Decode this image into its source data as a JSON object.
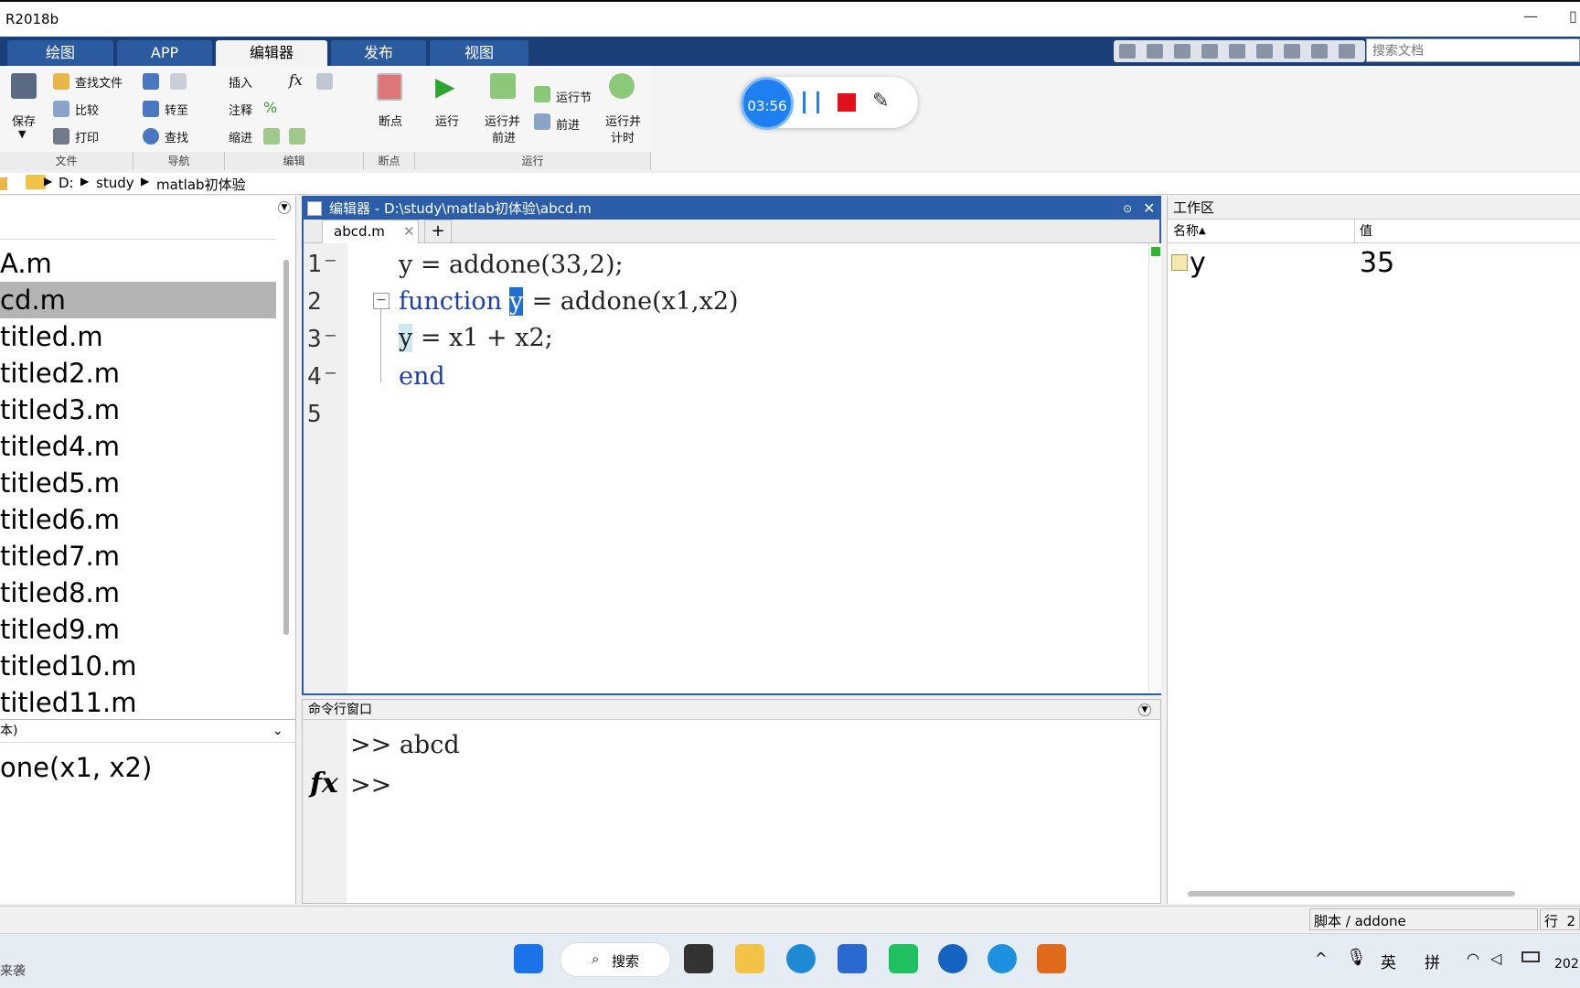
{
  "window": {
    "title": "R2018b"
  },
  "tabs": [
    "绘图",
    "APP",
    "编辑器",
    "发布",
    "视图"
  ],
  "search_placeholder": "搜索文档",
  "ribbon": {
    "file": {
      "save": "保存",
      "find_files": "查找文件",
      "compare": "比较",
      "print": "打印",
      "group": "文件"
    },
    "nav": {
      "goto": "转至",
      "find": "查找",
      "group": "导航"
    },
    "edit": {
      "insert": "插入",
      "comment": "注释",
      "indent": "缩进",
      "fx": "fx",
      "group": "编辑"
    },
    "breakpoints": {
      "label": "断点",
      "group": "断点"
    },
    "run": {
      "run": "运行",
      "run_advance_1": "运行并",
      "run_advance_2": "前进",
      "run_section": "运行节",
      "advance": "前进",
      "run_time_1": "运行并",
      "run_time_2": "计时",
      "group": "运行"
    }
  },
  "recorder": {
    "time": "03:56"
  },
  "path": [
    "D:",
    "study",
    "matlab初体验"
  ],
  "files": {
    "items": [
      "A.m",
      "cd.m",
      "titled.m",
      "titled2.m",
      "titled3.m",
      "titled4.m",
      "titled5.m",
      "titled6.m",
      "titled7.m",
      "titled8.m",
      "titled9.m",
      "titled10.m",
      "titled11.m"
    ],
    "selected_index": 1,
    "details_header": "本)",
    "details_sig": "one(x1, x2)"
  },
  "editor": {
    "title": "编辑器 - D:\\study\\matlab初体验\\abcd.m",
    "tab": "abcd.m",
    "add_tab": "+",
    "line_numbers": [
      "1",
      "2",
      "3",
      "4",
      "5"
    ],
    "lines": [
      "y = addone(33,2);",
      "function",
      "y",
      " = addone(x1,x2)",
      "y = x1 + x2;",
      "end"
    ]
  },
  "command": {
    "title": "命令行窗口",
    "line1": ">> abcd",
    "prompt": ">>",
    "fx": "fx"
  },
  "workspace": {
    "title": "工作区",
    "col_name": "名称",
    "col_value": "值",
    "rows": [
      {
        "name": "y",
        "value": "35"
      }
    ]
  },
  "status": {
    "script": "脚本 / addone",
    "row": "行  2"
  },
  "taskbar": {
    "search": "搜索",
    "bottom_left": "来袭",
    "tray_en": "英",
    "tray_pin": "拼",
    "clock": "202"
  }
}
